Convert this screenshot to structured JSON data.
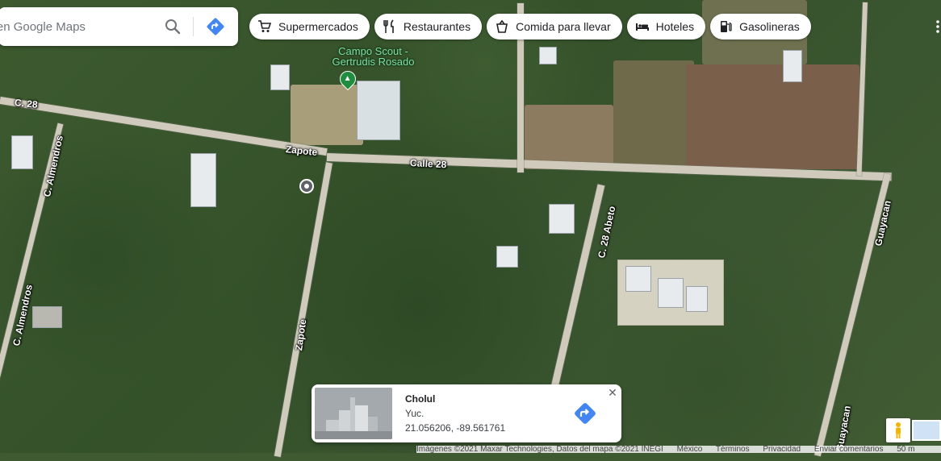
{
  "search": {
    "placeholder": "Buscar en Google Maps",
    "search_icon": "search-icon",
    "directions_icon": "directions-icon"
  },
  "chips": [
    {
      "label": "Supermercados",
      "icon": "cart-icon"
    },
    {
      "label": "Restaurantes",
      "icon": "fork-knife-icon"
    },
    {
      "label": "Comida para llevar",
      "icon": "takeout-icon"
    },
    {
      "label": "Hoteles",
      "icon": "bed-icon"
    },
    {
      "label": "Gasolineras",
      "icon": "fuel-icon"
    }
  ],
  "map": {
    "poi": {
      "name_line1": "Campo Scout -",
      "name_line2": "Gertrudis Rosado"
    },
    "roads": {
      "c28": "C. 28",
      "zapote_h": "Zapote",
      "calle28": "Calle 28",
      "almendros_top": "C. Almendros",
      "almendros_bottom": "C. Almendros",
      "zapote_v": "Zapote",
      "c28_abeto": "C. 28 Abeto",
      "guayacan_top": "Guayacan",
      "guayacan_bottom": "Guayacan"
    }
  },
  "infocard": {
    "title": "Cholul",
    "subtitle": "Yuc.",
    "coordinates": "21.056206, -89.561761",
    "close": "✕"
  },
  "bottombar": {
    "imagery": "Imágenes ©2021 Maxar Technologies, Datos del mapa ©2021 INEGI",
    "country": "México",
    "terms": "Términos",
    "privacy": "Privacidad",
    "feedback": "Enviar comentarios",
    "scale": "50 m"
  },
  "colors": {
    "accent_blue": "#4285f4",
    "poi_green": "#1e8e3e"
  }
}
